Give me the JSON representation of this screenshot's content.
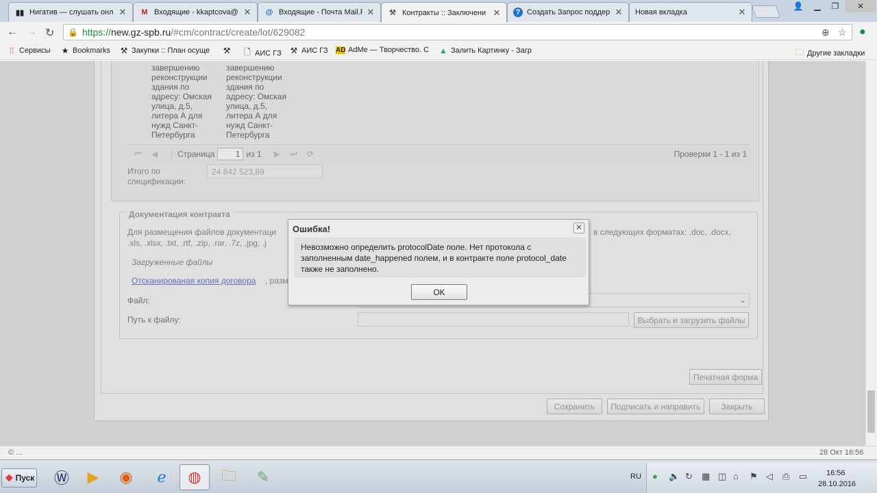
{
  "tabs": [
    {
      "label": "Нигатив — слушать онл",
      "icon": "play-icon"
    },
    {
      "label": "Входящие - kkaptcova@",
      "icon": "gmail-icon"
    },
    {
      "label": "Входящие - Почта Mail.R",
      "icon": "mail-ru-icon"
    },
    {
      "label": "Контракты :: Заключени",
      "icon": "gavel-icon",
      "active": true
    },
    {
      "label": "Создать Запрос поддер",
      "icon": "help-icon"
    },
    {
      "label": "Новая вкладка",
      "icon": ""
    }
  ],
  "address": {
    "scheme": "https://",
    "host": "new.gz-spb.ru",
    "path": "/#cm/contract/create/lot/629082"
  },
  "bookmarks": {
    "items": [
      {
        "label": "Сервисы",
        "icon": "apps-icon"
      },
      {
        "label": "Bookmarks",
        "icon": "star-icon"
      },
      {
        "label": "Закупки :: План осуще",
        "icon": "gavel-icon"
      },
      {
        "label": "",
        "icon": "gavel-icon"
      },
      {
        "label": "АИС ГЗ",
        "icon": "page-icon"
      },
      {
        "label": "АИС ГЗ",
        "icon": "gavel-icon"
      },
      {
        "label": "AdMe — Творчество. С",
        "icon": "adme-icon"
      },
      {
        "label": "Залить Картинку - Загр",
        "icon": "image-icon"
      }
    ],
    "other": "Другие закладки"
  },
  "spec": {
    "col1": "завершению реконструкции здания по адресу: Омская улица, д.5, литера А для нужд Санкт-Петербурга",
    "col2": "завершению реконструкции здания по адресу: Омская улица, д.5, литера А для нужд Санкт-Петербурга"
  },
  "pager": {
    "page_label": "Страница",
    "page_value": "1",
    "of_label": "из 1",
    "summary": "Проверки 1 - 1 из 1"
  },
  "total": {
    "label": "Итого по спецификации:",
    "value": "24 842 523,89"
  },
  "docs": {
    "legend": "Документация контракта",
    "info_left": "Для размещения файлов документаци",
    "info_right": "в следующих форматах: .doc, .docx,",
    "info_line2": ".xls, .xlsx, .txt, .rtf, .zip, .rar, .7z, .jpg, .j",
    "uploaded_label": "Загруженные файлы",
    "file_link": "Отсканированая копия договора",
    "file_meta": ", разм",
    "file_label": "Файл:",
    "path_label": "Путь к файлу:",
    "upload_button": "Выбрать и загрузить файлы"
  },
  "actions": {
    "print": "Печатная форма",
    "save": "Сохранить",
    "sign": "Подписать и направить",
    "close": "Закрыть"
  },
  "dialog": {
    "title": "Ошибка!",
    "message": "Невозможно определить protocolDate поле. Нет протокола с заполненным date_happened полем, и в контракте поле protocol_date также не заполнено.",
    "ok": "OK"
  },
  "status": {
    "left": "© ...",
    "right": "28 Окт 16:56"
  },
  "taskbar": {
    "start": "Пуск",
    "lang": "RU",
    "time": "16:56",
    "date": "28.10.2016"
  }
}
